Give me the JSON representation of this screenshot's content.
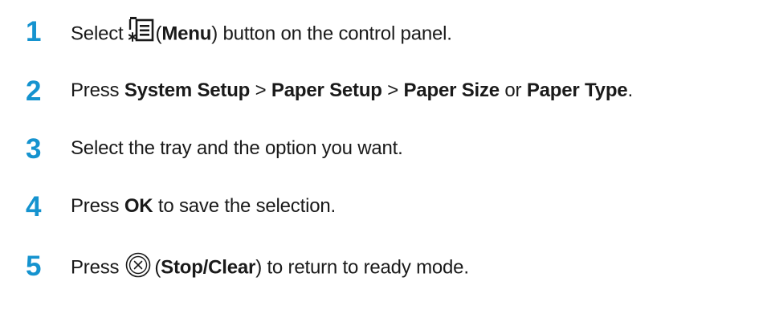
{
  "steps": [
    {
      "number": "1",
      "before": "Select",
      "icon": "menu-icon",
      "paren_open": "(",
      "bold1": "Menu",
      "paren_close": ")",
      "after": " button on the control panel."
    },
    {
      "number": "2",
      "before": "Press ",
      "bold1": "System Setup",
      "sep1": " > ",
      "bold2": "Paper Setup",
      "sep2": " > ",
      "bold3": "Paper Size",
      "sep3": " or ",
      "bold4": "Paper Type",
      "after": "."
    },
    {
      "number": "3",
      "text": "Select the tray and the option you want."
    },
    {
      "number": "4",
      "before": "Press ",
      "bold1": "OK",
      "after": " to save the selection."
    },
    {
      "number": "5",
      "before": "Press",
      "icon": "stop-clear-icon",
      "paren_open": "(",
      "bold1": "Stop/Clear",
      "paren_close": ")",
      "after": " to return to ready mode."
    }
  ],
  "colors": {
    "step_number": "#1593cf",
    "text": "#1a1a1a"
  }
}
